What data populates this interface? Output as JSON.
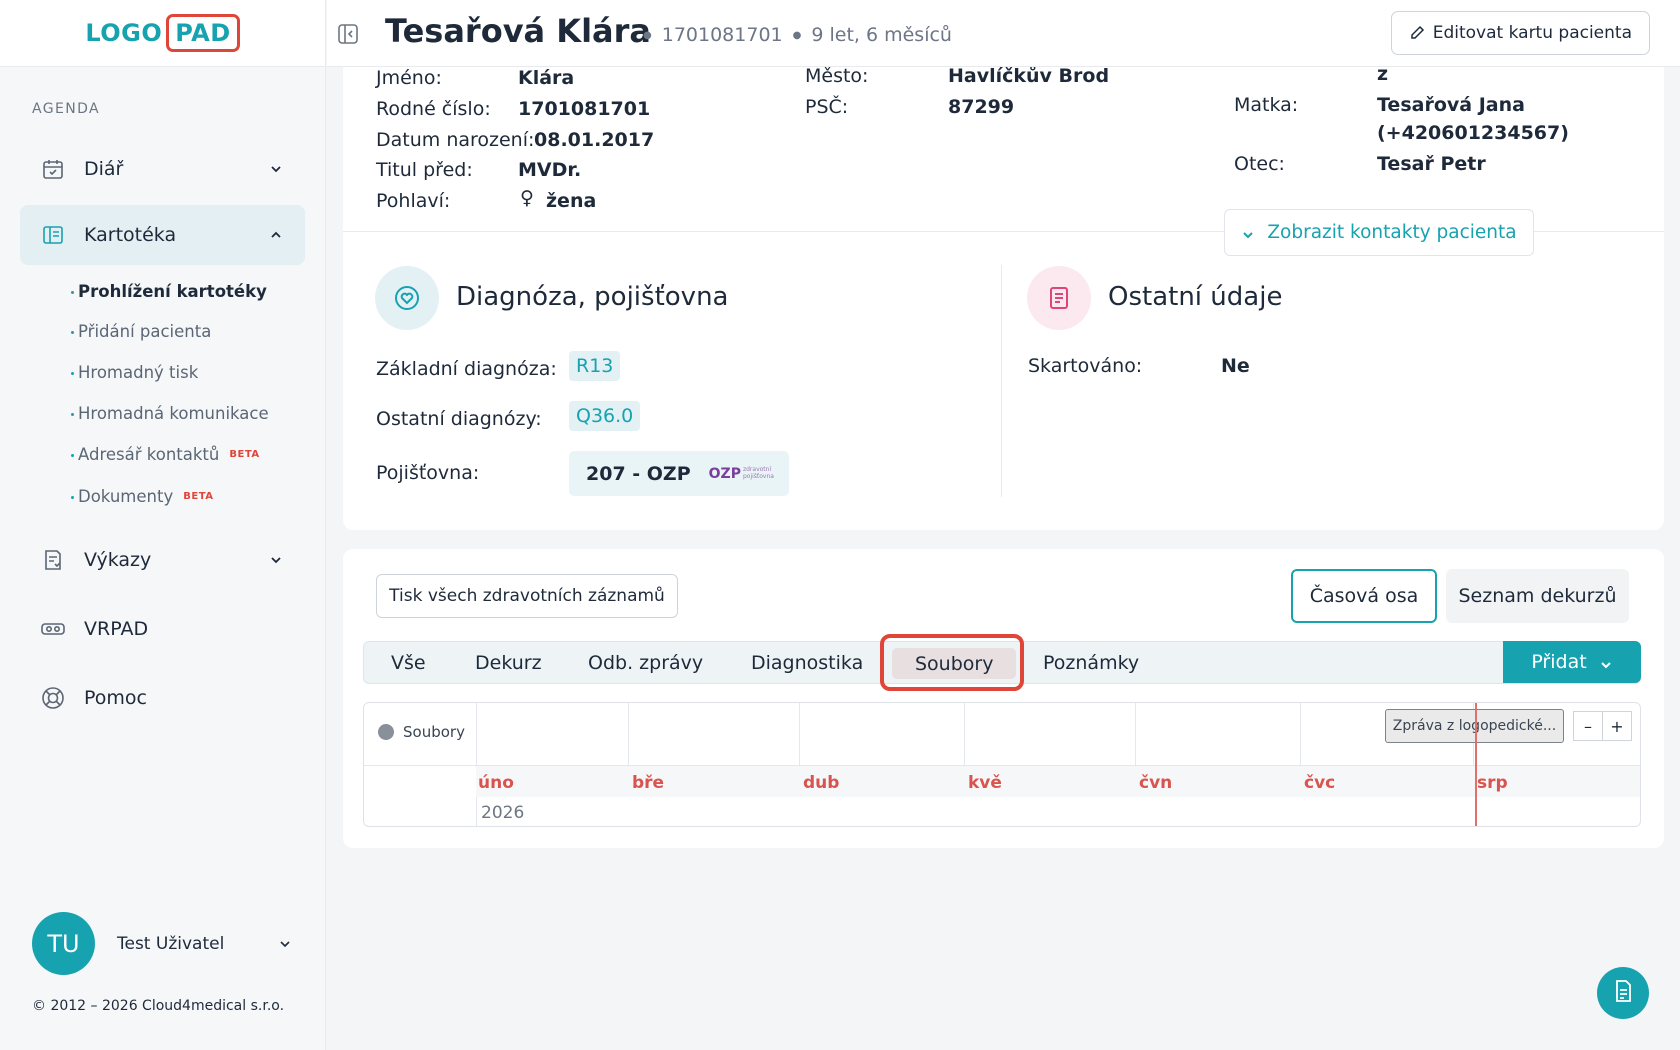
{
  "logo": {
    "part1": "LOGO",
    "part2": "PAD"
  },
  "sidebar": {
    "agenda_label": "AGENDA",
    "items": [
      {
        "label": "Diář",
        "icon": "calendar-icon"
      },
      {
        "label": "Kartotéka",
        "icon": "card-file-icon"
      },
      {
        "label": "Výkazy",
        "icon": "report-icon"
      },
      {
        "label": "VRPAD",
        "icon": "vr-headset-icon"
      },
      {
        "label": "Pomoc",
        "icon": "lifebuoy-icon"
      }
    ],
    "subitems": [
      {
        "label": "Prohlížení kartotéky"
      },
      {
        "label": "Přidání pacienta"
      },
      {
        "label": "Hromadný tisk"
      },
      {
        "label": "Hromadná komunikace"
      },
      {
        "label": "Adresář kontaktů",
        "badge": "BETA"
      },
      {
        "label": "Dokumenty",
        "badge": "BETA"
      }
    ],
    "user": {
      "initials": "TU",
      "name": "Test Uživatel"
    },
    "copyright": "© 2012 – 2026 Cloud4medical s.r.o."
  },
  "header": {
    "patient_name": "Tesařová Klára",
    "birth_number": "1701081701",
    "age": "9 let, 6 měsíců",
    "edit_button": "Editovat kartu pacienta"
  },
  "personal": {
    "first_name_label": "Jméno:",
    "first_name": "Klára",
    "birth_no_label": "Rodné číslo:",
    "birth_no": "1701081701",
    "dob_label": "Datum narození:",
    "dob": "08.01.2017",
    "title_label": "Titul před:",
    "title": "MVDr.",
    "gender_label": "Pohlaví:",
    "gender_symbol": "♀",
    "gender": "žena",
    "city_label": "Město:",
    "city": "Havlíčkův Brod",
    "zip_label": "PSČ:",
    "zip": "87299",
    "top_fragment": "z",
    "mother_label": "Matka:",
    "mother_name": "Tesařová Jana",
    "mother_phone": "(+420601234567)",
    "father_label": "Otec:",
    "father": "Tesař Petr",
    "contacts_button": "Zobrazit kontakty pacienta"
  },
  "diagnosis": {
    "title": "Diagnóza, pojišťovna",
    "main_label": "Základní diagnóza:",
    "main": "R13",
    "other_label": "Ostatní diagnózy:",
    "other": "Q36.0",
    "insurance_label": "Pojišťovna:",
    "insurance": "207 - OZP",
    "insurance_logo": "OZP",
    "insurance_logo_sub1": "zdravotní",
    "insurance_logo_sub2": "pojišťovna"
  },
  "other_info": {
    "title": "Ostatní údaje",
    "shredded_label": "Skartováno:",
    "shredded": "Ne"
  },
  "records": {
    "print_button": "Tisk všech zdravotních záznamů",
    "view_timeline": "Časová osa",
    "view_list": "Seznam dekurzů",
    "tabs": [
      "Vše",
      "Dekurz",
      "Odb. zprávy",
      "Diagnostika",
      "Soubory",
      "Poznámky"
    ],
    "selected_tab": "Soubory",
    "add_button": "Přidat"
  },
  "timeline": {
    "group_label": "Soubory",
    "months": [
      "úno",
      "bře",
      "dub",
      "kvě",
      "čvn",
      "čvc",
      "srp"
    ],
    "year": "2026",
    "item": "Zpráva z logopedické...",
    "zoom_out": "–",
    "zoom_in": "+"
  },
  "colors": {
    "accent": "#17a2b0",
    "highlight": "#e0453a"
  }
}
